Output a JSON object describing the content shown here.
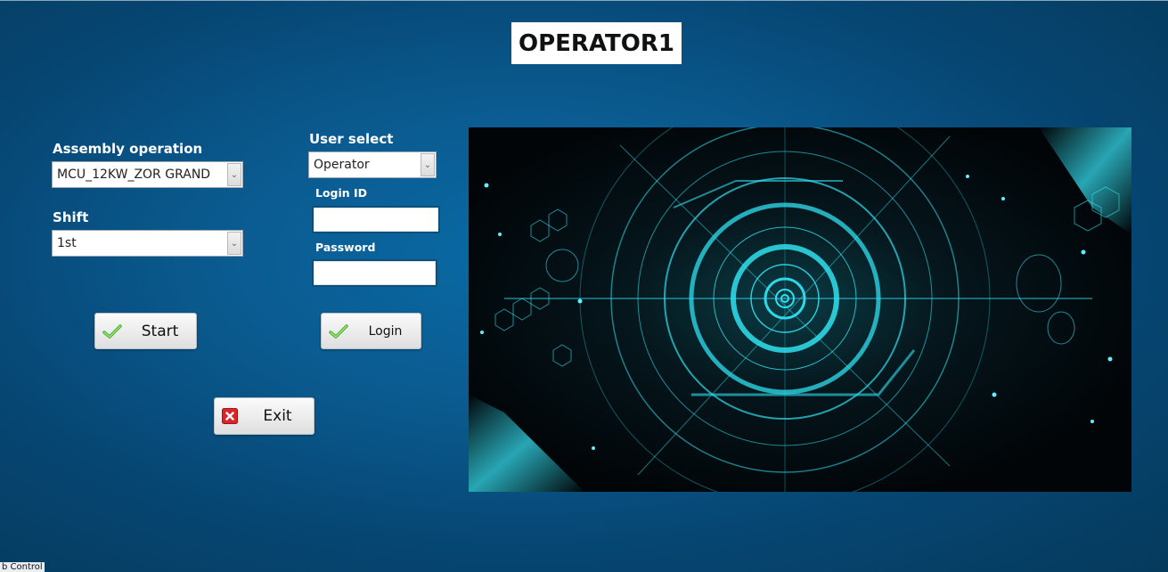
{
  "header": {
    "title": "OPERATOR1"
  },
  "left_form": {
    "assembly_label": "Assembly operation",
    "assembly_value": "MCU_12KW_ZOR GRAND",
    "shift_label": "Shift",
    "shift_value": "1st",
    "start_label": "Start",
    "exit_label": "Exit"
  },
  "login_form": {
    "user_select_label": "User select",
    "user_select_value": "Operator",
    "login_id_label": "Login ID",
    "login_id_value": "",
    "password_label": "Password",
    "password_value": "",
    "login_label": "Login"
  },
  "icons": {
    "start": "check-icon",
    "login": "check-icon",
    "exit": "close-icon",
    "dropdown": "chevron-down-icon",
    "hero": "futuristic-hud-image"
  },
  "colors": {
    "background": "#0a5a8f",
    "hero_accent": "#2fe0f0",
    "check_green": "#5cc83a",
    "exit_red": "#d9262c"
  },
  "status_bar": {
    "text": "b Control"
  }
}
